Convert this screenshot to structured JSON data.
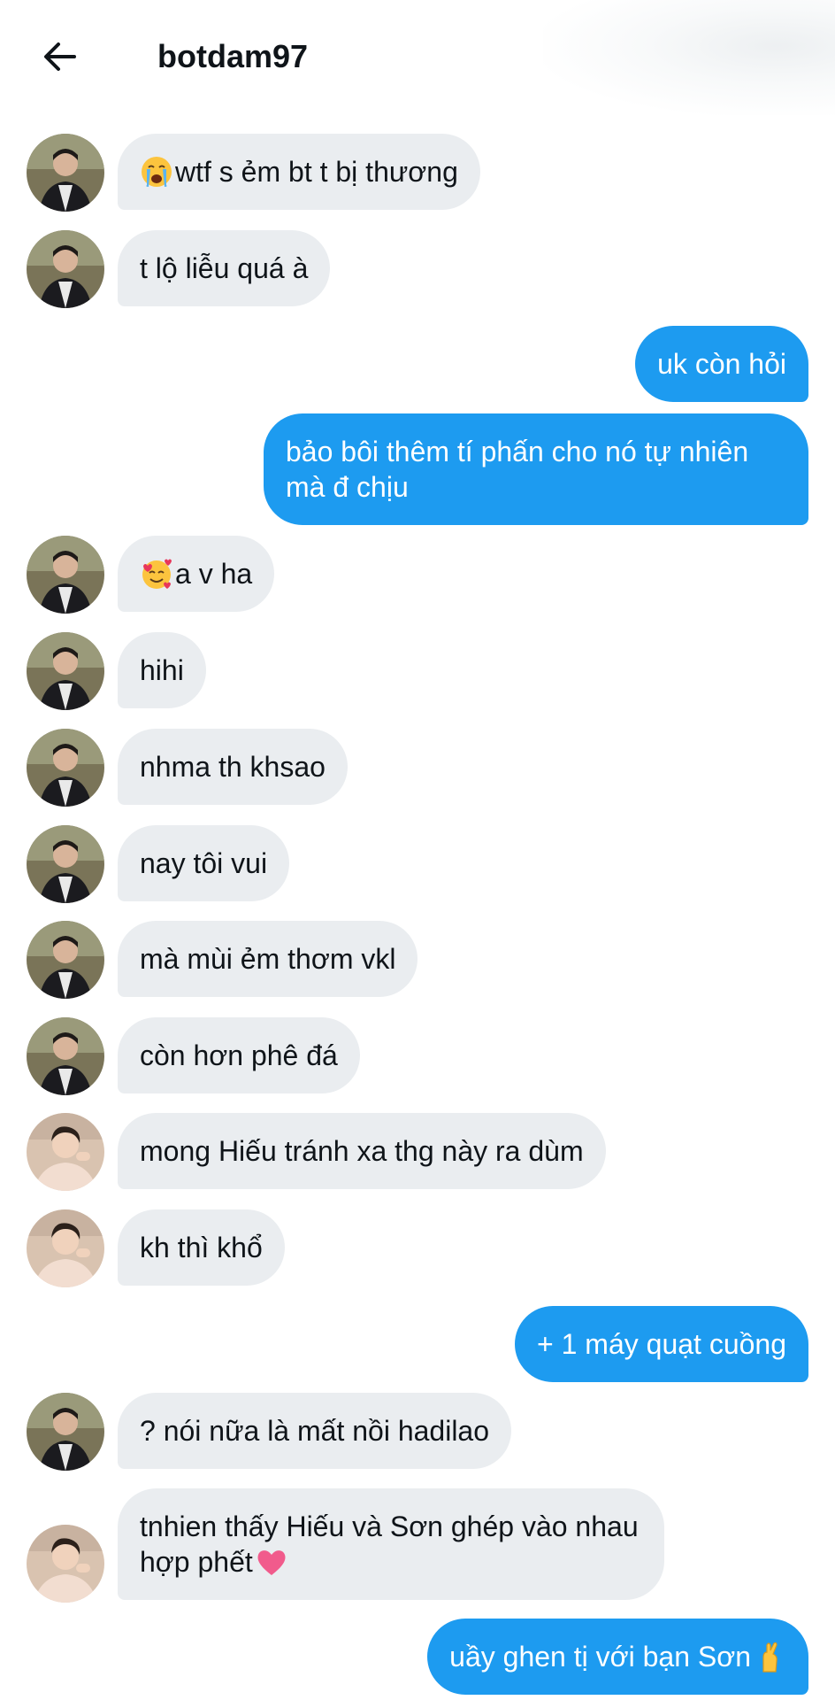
{
  "header": {
    "title": "botdam97",
    "back_icon": "arrow-left-icon"
  },
  "colors": {
    "incoming_bubble": "#eaedf0",
    "outgoing_bubble": "#1d9bf0",
    "outgoing_text": "#ffffff",
    "text": "#0f1419"
  },
  "messages": [
    {
      "dir": "in",
      "avatar": "user-a",
      "emoji_before": "crying-face-emoji",
      "text": "wtf s ẻm bt t bị thương"
    },
    {
      "dir": "in",
      "avatar": "user-a",
      "text": "t lộ liễu quá à"
    },
    {
      "dir": "out",
      "text": "uk còn hỏi"
    },
    {
      "dir": "out",
      "text": "bảo bôi thêm tí phấn cho nó tự nhiên mà đ chịu"
    },
    {
      "dir": "in",
      "avatar": "user-a",
      "emoji_before": "smiling-face-with-hearts-emoji",
      "text": "a v ha"
    },
    {
      "dir": "in",
      "avatar": "user-a",
      "text": "hihi"
    },
    {
      "dir": "in",
      "avatar": "user-a",
      "text": "nhma th khsao"
    },
    {
      "dir": "in",
      "avatar": "user-a",
      "text": "nay tôi vui"
    },
    {
      "dir": "in",
      "avatar": "user-a",
      "text": "mà mùi ẻm thơm vkl"
    },
    {
      "dir": "in",
      "avatar": "user-a",
      "text": "còn hơn phê đá"
    },
    {
      "dir": "in",
      "avatar": "user-b",
      "text": "mong Hiếu tránh xa thg này ra dùm"
    },
    {
      "dir": "in",
      "avatar": "user-b",
      "text": "kh thì khổ"
    },
    {
      "dir": "out",
      "text": "+ 1 máy quạt cuồng"
    },
    {
      "dir": "in",
      "avatar": "user-a",
      "text": "? nói nữa là mất nồi hadilao"
    },
    {
      "dir": "in",
      "avatar": "user-b",
      "emoji_after": "pink-heart-emoji",
      "text": "tnhien thấy Hiếu và Sơn ghép vào nhau hợp phết"
    },
    {
      "dir": "out",
      "emoji_after": "crossed-fingers-emoji",
      "text": "uầy ghen tị với bạn Sơn"
    }
  ]
}
